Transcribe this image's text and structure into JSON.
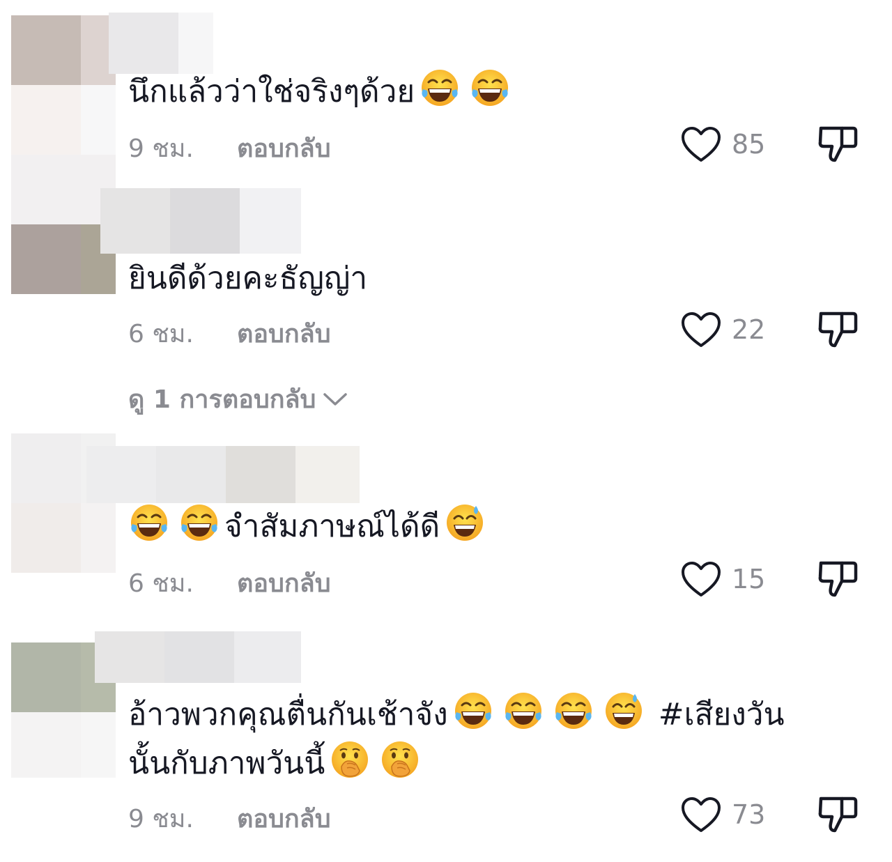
{
  "comments": [
    {
      "text": "นึกแล้วว่าใช่จริงๆด้วย",
      "emojis_after": [
        "laugh-tears",
        "laugh-tears"
      ],
      "time": "9 ชม.",
      "reply_label": "ตอบกลับ",
      "likes": "85"
    },
    {
      "text": "ยินดีด้วยคะธัญญ่า",
      "time": "6 ชม.",
      "reply_label": "ตอบกลับ",
      "likes": "22",
      "view_replies": "ดู 1 การตอบกลับ"
    },
    {
      "text": "จำสัมภาษณ์ได้ดี",
      "emojis_before": [
        "laugh-tears",
        "laugh-tears"
      ],
      "emojis_after": [
        "sweat-smile"
      ],
      "time": "6 ชม.",
      "reply_label": "ตอบกลับ",
      "likes": "15"
    },
    {
      "text_line1": "อ้าวพวกคุณตื่นกันเช้าจัง",
      "emojis_line1": [
        "laugh-tears",
        "laugh-tears",
        "laugh-tears",
        "sweat-smile"
      ],
      "hashtag": "#เสียงวัน",
      "text_line2": "นั้นกับภาพวันนี้",
      "emojis_line2": [
        "hand-over-mouth",
        "hand-over-mouth"
      ],
      "time": "9 ชม.",
      "reply_label": "ตอบกลับ",
      "likes": "73"
    }
  ],
  "icons": {
    "like": "heart-outline-icon",
    "dislike": "thumbs-down-outline-icon",
    "expand": "chevron-down-icon"
  },
  "colors": {
    "text": "#161823",
    "meta": "#8a8b91"
  }
}
